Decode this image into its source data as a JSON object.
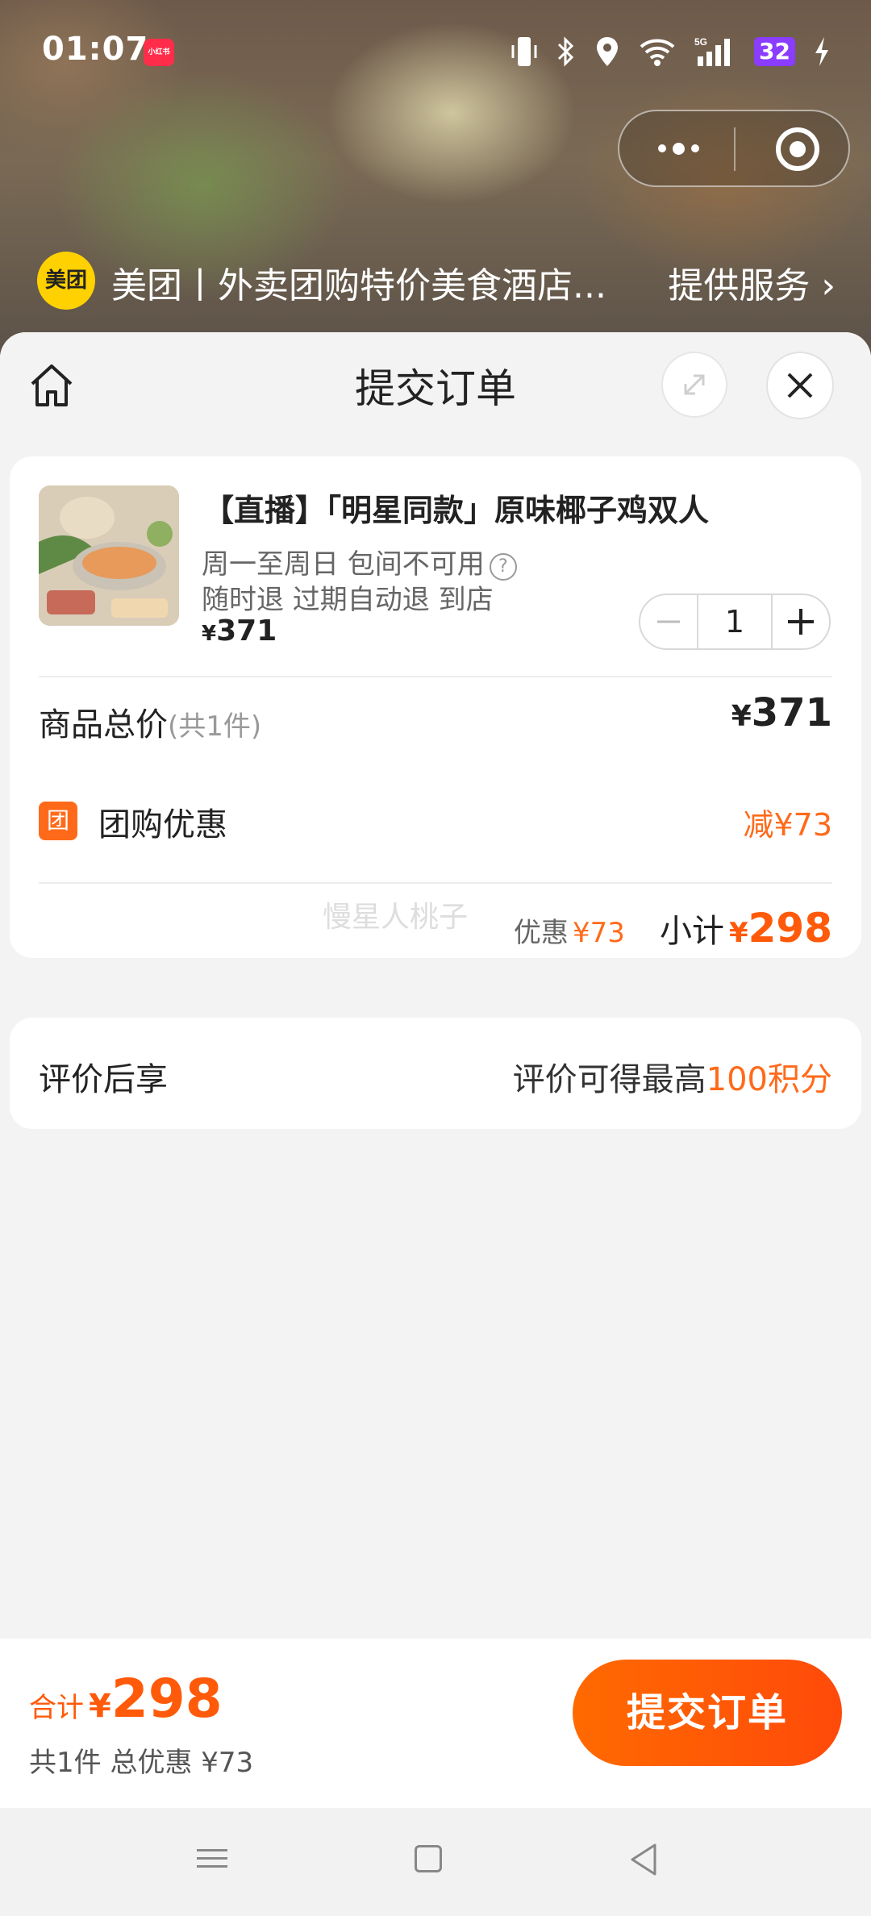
{
  "status": {
    "time": "01:07",
    "app_badge": "小红书",
    "network": "5G",
    "battery": "32"
  },
  "brand": {
    "logo_text": "美团",
    "title": "美团丨外卖团购特价美食酒店...",
    "service_link": "提供服务 ›"
  },
  "sheet": {
    "title": "提交订单"
  },
  "product": {
    "name": "【直播】「明星同款」原味椰子鸡双人",
    "availability": "周一至周日 包间不可用",
    "policy": "随时退 过期自动退 到店",
    "price_symbol": "¥",
    "price": "371",
    "quantity": "1"
  },
  "summary": {
    "total_label": "商品总价",
    "total_count": "(共1件)",
    "total_symbol": "¥",
    "total_value": "371",
    "group_icon": "团",
    "group_label": "团购优惠",
    "group_value": "减¥73",
    "watermark": "慢星人桃子",
    "discount_label": "优惠",
    "discount_value": "¥73",
    "subtotal_label": "小计",
    "subtotal_symbol": "¥",
    "subtotal_value": "298"
  },
  "review": {
    "label": "评价后享",
    "text_prefix": "评价可得最高",
    "text_highlight": "100积分"
  },
  "bottom": {
    "total_label": "合计",
    "total_symbol": "¥",
    "total_value": "298",
    "sub": "共1件 总优惠 ¥73",
    "submit_label": "提交订单"
  },
  "colors": {
    "accent": "#ff5a0a",
    "brand_yellow": "#ffd100"
  }
}
